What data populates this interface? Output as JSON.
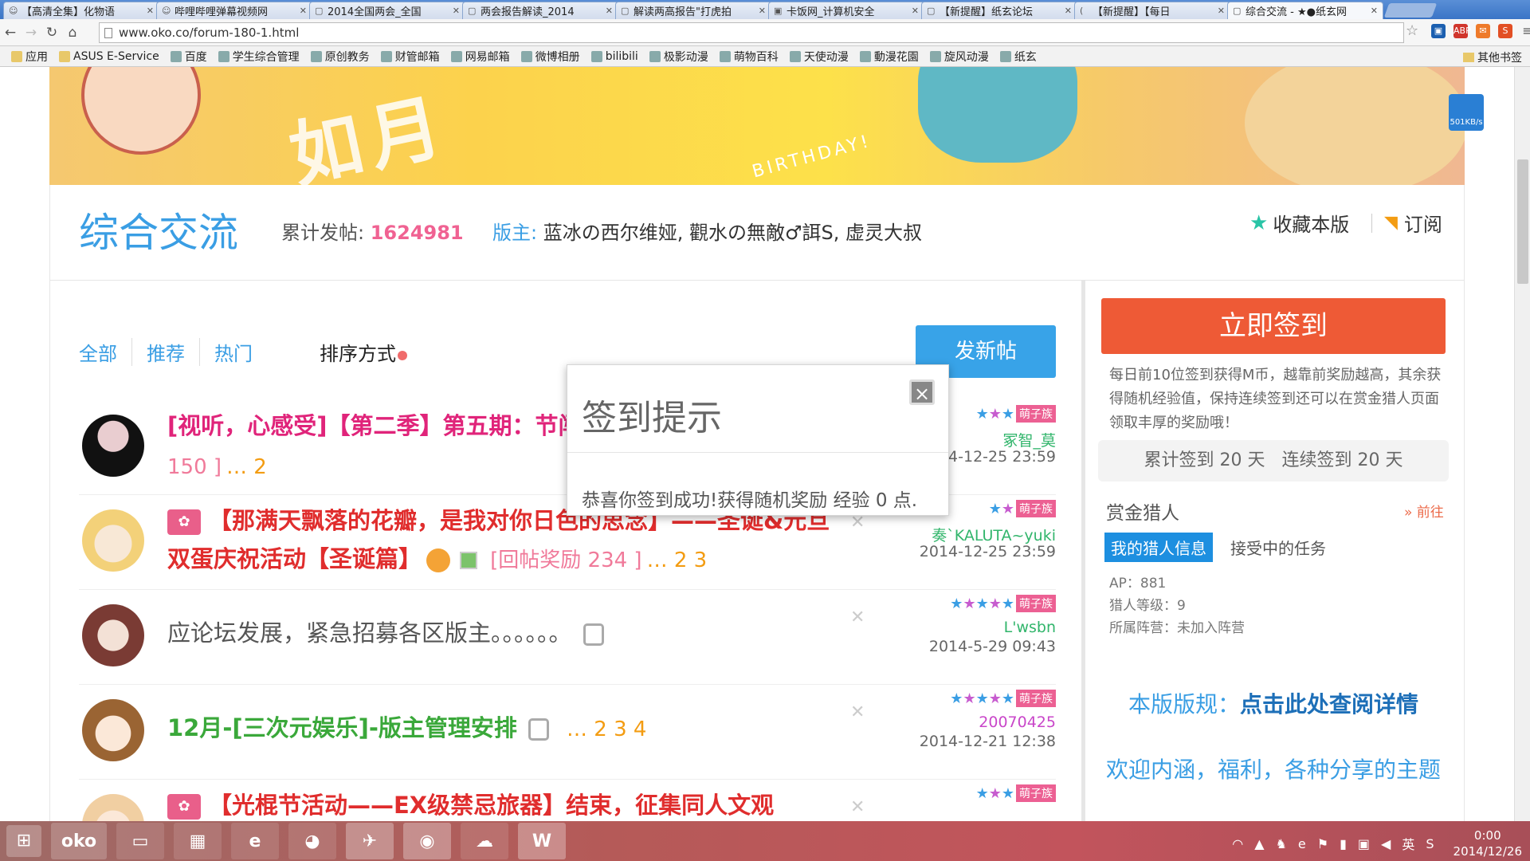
{
  "tabs": [
    {
      "title": "【高清全集】化物语",
      "icon": "☺"
    },
    {
      "title": "哔哩哔哩弹幕视频网",
      "icon": "☺"
    },
    {
      "title": "2014全国两会_全国",
      "icon": "▢"
    },
    {
      "title": "两会报告解读_2014",
      "icon": "▢"
    },
    {
      "title": "解读两高报告\"打虎拍",
      "icon": "▢"
    },
    {
      "title": "卡饭网_计算机安全",
      "icon": "▣"
    },
    {
      "title": "【新提醒】纸玄论坛",
      "icon": "▢"
    },
    {
      "title": "【新提醒】【每日",
      "icon": "("
    },
    {
      "title": "综合交流 - ★●纸玄网",
      "icon": "▢"
    }
  ],
  "browser": {
    "url": "www.oko.co/forum-180-1.html"
  },
  "bookmarks": [
    "应用",
    "ASUS E-Service",
    "百度",
    "学生综合管理",
    "原创教务",
    "财管邮箱",
    "网易邮箱",
    "微博相册",
    "bilibili",
    "极影动漫",
    "萌物百科",
    "天使动漫",
    "動漫花園",
    "旋风动漫",
    "纸玄"
  ],
  "bookmarks_other": "其他书签",
  "speed": "501KB/s",
  "forum": {
    "title": "综合交流",
    "count_label": "累计发帖:",
    "count": "1624981",
    "mods_label": "版主:",
    "mods": "蓝冰の西尔维娅, 觀水の無敵♂誀S, 虚灵大叔",
    "favorite": "收藏本版",
    "subscribe": "订阅"
  },
  "filters": [
    "全部",
    "推荐",
    "热门"
  ],
  "sort_label": "排序方式",
  "new_post": "发新帖",
  "threads": [
    {
      "title": "[视听，心感受]【第二季】第五期：节闯关活动",
      "reward": "[回帖奖励 150 ]",
      "pages": "… 2",
      "rank": "萌子族",
      "author": "冢智_莫",
      "date": "2014-12-25 23:59",
      "style": "pink"
    },
    {
      "title": "【那满天飘落的花瓣，是我对你日色的思念】——圣诞&元旦 双蛋庆祝活动【圣诞篇】",
      "reward": "[回帖奖励 234 ]",
      "pages": "… 2  3",
      "rank": "萌子族",
      "author": "奏`KALUTA~yuki",
      "date": "2014-12-25 23:59",
      "style": "red"
    },
    {
      "title": "应论坛发展，紧急招募各区版主。。。。。。",
      "reward": "",
      "pages": "",
      "rank": "萌子族",
      "author": "L'wsbn",
      "date": "2014-5-29 09:43",
      "style": "gray"
    },
    {
      "title": "12月-[三次元娱乐]-版主管理安排",
      "reward": "",
      "pages": "… 2  3  4",
      "rank": "萌子族",
      "author": "20070425",
      "date": "2014-12-21 12:38",
      "style": "green"
    },
    {
      "title": "【光棍节活动——EX级禁忌旅器】结束，征集同人文观",
      "reward": "",
      "pages": "",
      "rank": "萌子族",
      "author": "",
      "date": "",
      "style": "red"
    }
  ],
  "sidebar": {
    "sign_button": "立即签到",
    "sign_desc": "每日前10位签到获得M币，越靠前奖励越高，其余获得随机经验值，保持连续签到还可以在赏金猎人页面领取丰厚的奖励哦！",
    "sign_stats": "累计签到 20 天   连续签到 20 天",
    "hunter_title": "赏金猎人",
    "hunter_go": "» 前往",
    "hunter_tabs": [
      "我的猎人信息",
      "接受中的任务"
    ],
    "hunter_info": [
      "AP：881",
      "猎人等级：9",
      "所属阵营：未加入阵营"
    ],
    "rules_label": "本版版规：",
    "rules_link": "点击此处查阅详情",
    "welcome": "欢迎内涵，福利，各种分享的主题"
  },
  "modal": {
    "title": "签到提示",
    "close": "×",
    "body": "恭喜你签到成功!获得随机奖励 经验 0 点."
  },
  "taskbar": {
    "time": "0:00",
    "date": "2014/12/26",
    "lang": "英"
  }
}
